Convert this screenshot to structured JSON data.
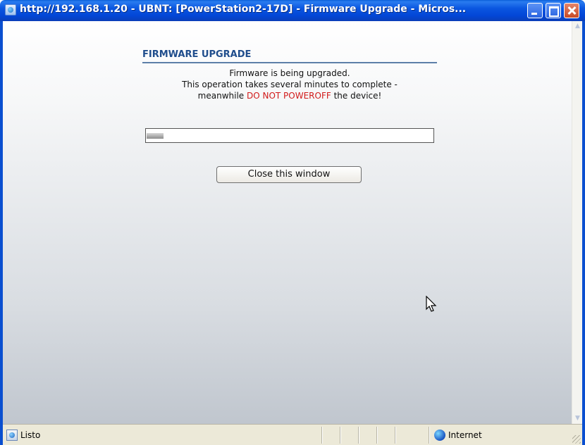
{
  "window": {
    "title": "http://192.168.1.20 - UBNT: [PowerStation2-17D] - Firmware Upgrade - Micros..."
  },
  "page": {
    "heading": "FIRMWARE UPGRADE",
    "message_line1": "Firmware is being upgraded.",
    "message_line2": "This operation takes several minutes to complete -",
    "message_line3_prefix": "meanwhile ",
    "message_line3_warning": "DO NOT POWEROFF",
    "message_line3_suffix": " the device!",
    "progress_fraction": 0.06,
    "close_button_label": "Close this window"
  },
  "statusbar": {
    "status_text": "Listo",
    "zone_text": "Internet"
  },
  "colors": {
    "heading": "#1f4d8c",
    "warning": "#d11a1a",
    "titlebar": "#0a56e0"
  },
  "icons": {
    "window": "ie-page-icon",
    "minimize": "minimize-icon",
    "maximize": "maximize-icon",
    "close": "close-icon",
    "status": "ie-page-icon",
    "zone": "globe-icon",
    "cursor": "mouse-pointer-icon"
  }
}
